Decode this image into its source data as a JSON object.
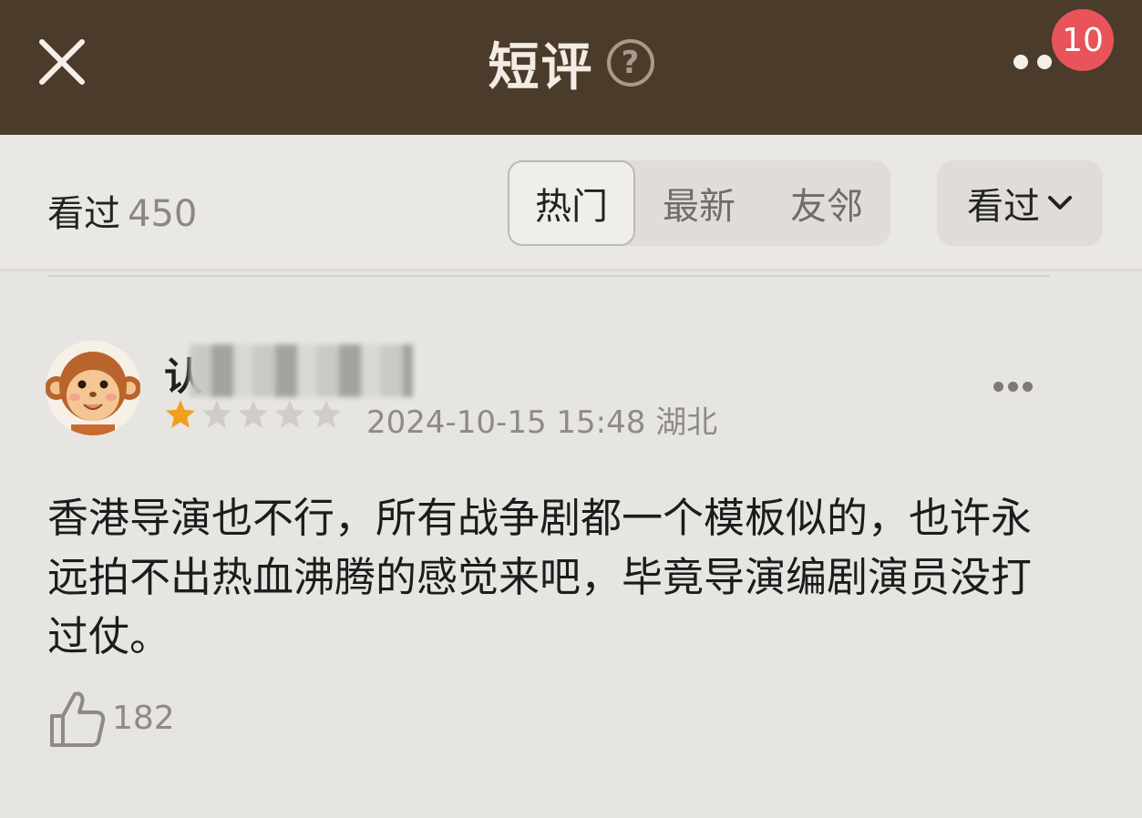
{
  "header": {
    "title": "短评",
    "help_icon": "question-circle-icon",
    "close_icon": "close-icon",
    "more_icon": "more-dots-icon",
    "notification_badge": "10"
  },
  "toolbar": {
    "label": "看过",
    "count": "450",
    "tabs": [
      {
        "label": "热门",
        "active": true
      },
      {
        "label": "最新",
        "active": false
      },
      {
        "label": "友邻",
        "active": false
      }
    ],
    "filter_label": "看过"
  },
  "review": {
    "username": "认",
    "rating": 1,
    "rating_max": 5,
    "meta": "2024-10-15 15:48 湖北",
    "content": "香港导演也不行，所有战争剧都一个模板似的，也许永远拍不出热血沸腾的感觉来吧，毕竟导演编剧演员没打过仗。",
    "likes": "182"
  },
  "colors": {
    "header_bg": "#4b3b2a",
    "badge": "#e9535a",
    "star_active": "#f0a01e",
    "star_inactive": "#d0cdc9"
  }
}
